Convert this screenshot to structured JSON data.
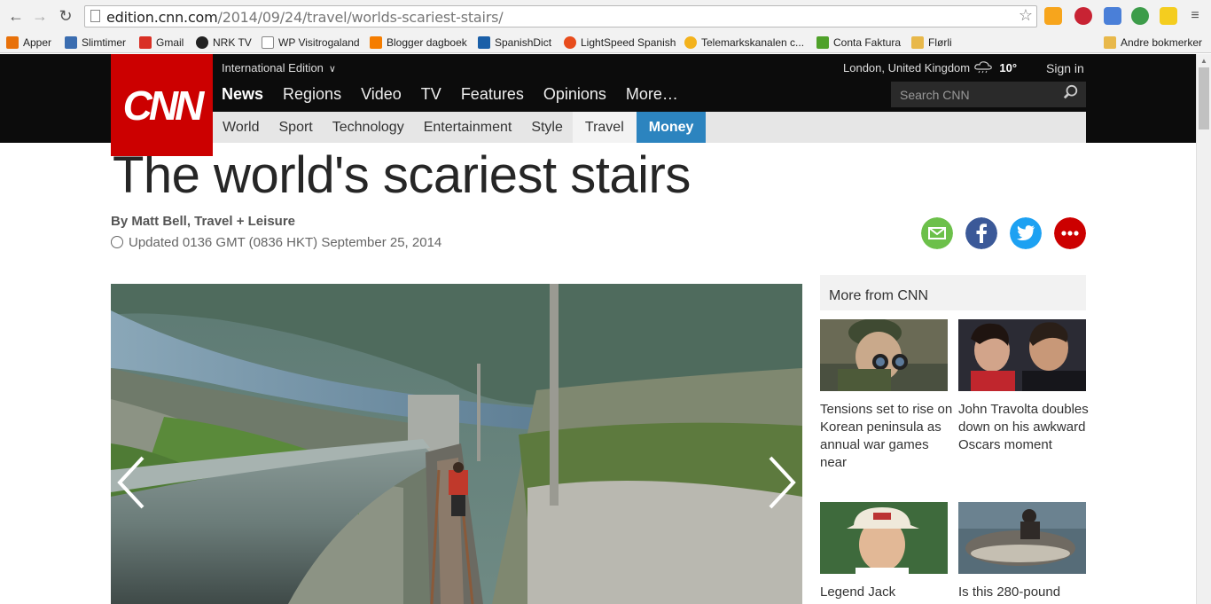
{
  "browser": {
    "url_host": "edition.cnn.com",
    "url_path": "/2014/09/24/travel/worlds-scariest-stairs/",
    "bookmarks": [
      {
        "label": "Apper",
        "color": "#e8710a"
      },
      {
        "label": "Slimtimer",
        "color": "#3b6db0"
      },
      {
        "label": "Gmail",
        "color": "#d93025"
      },
      {
        "label": "NRK TV",
        "color": "#222222"
      },
      {
        "label": "WP Visitrogaland",
        "color": "#777777"
      },
      {
        "label": "Blogger dagboek",
        "color": "#f57d00"
      },
      {
        "label": "SpanishDict",
        "color": "#1a5fa8"
      },
      {
        "label": "LightSpeed Spanish",
        "color": "#e84c1c"
      },
      {
        "label": "Telemarkskanalen c...",
        "color": "#f3b21c"
      },
      {
        "label": "Conta Faktura",
        "color": "#4fa12a"
      },
      {
        "label": "Flørli",
        "color": "#e8b84a"
      },
      {
        "label": "Andre bokmerker",
        "color": "#e8b84a"
      }
    ]
  },
  "header": {
    "logo": "CNN",
    "edition": "International Edition",
    "location": "London, United Kingdom",
    "temperature": "10°",
    "signin": "Sign in",
    "search_placeholder": "Search CNN",
    "main_nav": [
      "News",
      "Regions",
      "Video",
      "TV",
      "Features",
      "Opinions",
      "More…"
    ],
    "sub_nav": [
      "World",
      "Sport",
      "Technology",
      "Entertainment",
      "Style",
      "Travel",
      "Money"
    ]
  },
  "article": {
    "headline": "The world's scariest stairs",
    "byline": "By Matt Bell, Travel + Leisure",
    "updated": "Updated 0136 GMT (0836 HKT) September 25, 2014"
  },
  "share": [
    {
      "icon": "email-icon",
      "color": "#6cc04a"
    },
    {
      "icon": "facebook-icon",
      "color": "#3b5998"
    },
    {
      "icon": "twitter-icon",
      "color": "#1da1f2"
    },
    {
      "icon": "more-icon",
      "color": "#cc0000"
    }
  ],
  "sidebar": {
    "title": "More from CNN",
    "stories": [
      {
        "title": "Tensions set to rise on Korean peninsula as annual war games near"
      },
      {
        "title": "John Travolta doubles down on his awkward Oscars moment"
      },
      {
        "title": "Legend Jack"
      },
      {
        "title": "Is this 280-pound"
      }
    ]
  }
}
